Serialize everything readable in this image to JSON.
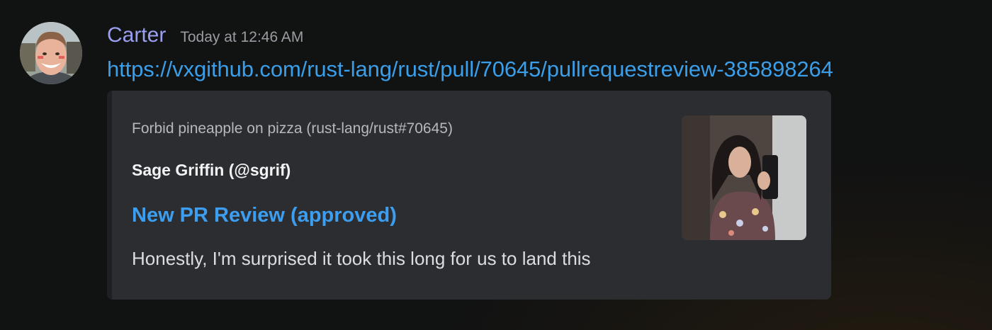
{
  "message": {
    "author": "Carter",
    "timestamp": "Today at 12:46 AM",
    "link": "https://vxgithub.com/rust-lang/rust/pull/70645/pullrequestreview-385898264"
  },
  "embed": {
    "provider": "Forbid pineapple on pizza (rust-lang/rust#70645)",
    "author": "Sage Griffin (@sgrif)",
    "title": "New PR Review (approved)",
    "description": "Honestly, I'm surprised it took this long for us to land this"
  },
  "colors": {
    "username": "#9b9ff0",
    "link": "#3a9ee8",
    "embed_background": "#2b2d31",
    "background": "#111212"
  },
  "icons": {
    "avatar": "user-avatar-photo",
    "thumbnail": "embed-thumbnail-photo"
  }
}
